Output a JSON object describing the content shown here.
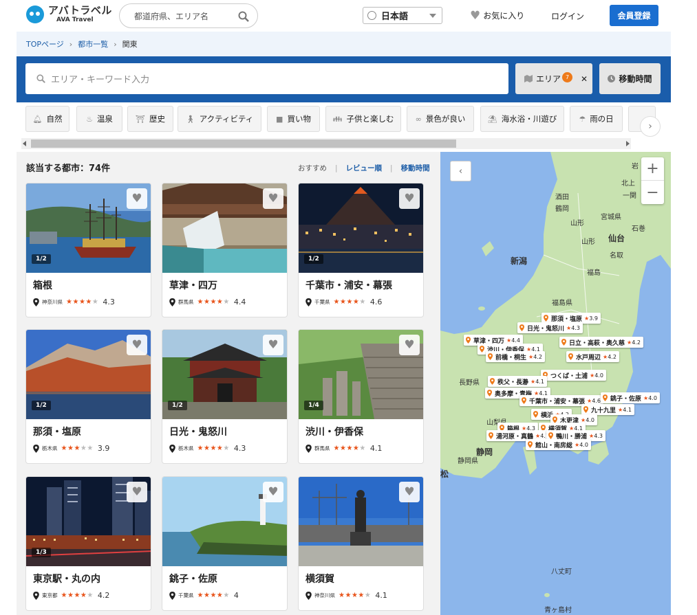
{
  "header": {
    "logo_jp": "アバトラベル",
    "logo_en": "AVA Travel",
    "search_placeholder": "都道府県、エリア名",
    "language": "日本語",
    "favorites": "お気に入り",
    "login": "ログイン",
    "register": "会員登録"
  },
  "breadcrumb": [
    "TOPページ",
    "都市一覧",
    "関東"
  ],
  "search": {
    "placeholder": "エリア・キーワード入力",
    "area_label": "エリア",
    "area_count": "7",
    "time_label": "移動時間"
  },
  "chips": [
    "自然",
    "温泉",
    "歴史",
    "アクティビティ",
    "買い物",
    "子供と楽しむ",
    "景色が良い",
    "海水浴・川遊び",
    "雨の日"
  ],
  "results": {
    "count_label": "該当する都市：74件",
    "sort_options": [
      "おすすめ",
      "レビュー順",
      "移動時間"
    ]
  },
  "cards": [
    {
      "name": "箱根",
      "pref": "神奈川県",
      "stars": 4,
      "rating": "4.3",
      "pager": "1/2"
    },
    {
      "name": "草津・四万",
      "pref": "群馬県",
      "stars": 4,
      "rating": "4.4",
      "pager": ""
    },
    {
      "name": "千葉市・浦安・幕張",
      "pref": "千葉県",
      "stars": 4,
      "rating": "4.6",
      "pager": "1/2"
    },
    {
      "name": "那須・塩原",
      "pref": "栃木県",
      "stars": 3,
      "rating": "3.9",
      "pager": "1/2"
    },
    {
      "name": "日光・鬼怒川",
      "pref": "栃木県",
      "stars": 4,
      "rating": "4.3",
      "pager": "1/2"
    },
    {
      "name": "渋川・伊香保",
      "pref": "群馬県",
      "stars": 4,
      "rating": "4.1",
      "pager": "1/4"
    },
    {
      "name": "東京駅・丸の内",
      "pref": "東京都",
      "stars": 4,
      "rating": "4.2",
      "pager": "1/3"
    },
    {
      "name": "銚子・佐原",
      "pref": "千葉県",
      "stars": 4,
      "rating": "4",
      "pager": ""
    },
    {
      "name": "横須賀",
      "pref": "神奈川県",
      "stars": 4,
      "rating": "4.1",
      "pager": ""
    }
  ],
  "map": {
    "labels": [
      "岩",
      "北上",
      "一関",
      "石巻",
      "酒田",
      "鶴岡",
      "山形",
      "宮城県",
      "山形",
      "仙台",
      "名取",
      "新潟",
      "福島",
      "福島県",
      "長野県",
      "山梨県",
      "静岡",
      "静岡県",
      "松",
      "八丈町",
      "青ヶ島村"
    ],
    "pins": [
      {
        "name": "那須・塩原",
        "rating": "3.9"
      },
      {
        "name": "日光・鬼怒川",
        "rating": "4.3"
      },
      {
        "name": "草津・四万",
        "rating": "4.4"
      },
      {
        "name": "渋川・伊香保",
        "rating": "4.1"
      },
      {
        "name": "日立・高萩・奥久慈",
        "rating": "4.2"
      },
      {
        "name": "前橋・桐生",
        "rating": "4.2"
      },
      {
        "name": "水戸周辺",
        "rating": "4.2"
      },
      {
        "name": "つくば・土浦",
        "rating": "4.0"
      },
      {
        "name": "秩父・長瀞",
        "rating": "4.1"
      },
      {
        "name": "奥多摩・青梅",
        "rating": "4.1"
      },
      {
        "name": "千葉市・浦安・幕張",
        "rating": "4.6"
      },
      {
        "name": "銚子・佐原",
        "rating": "4.0"
      },
      {
        "name": "九十九里",
        "rating": "4.1"
      },
      {
        "name": "横浜",
        "rating": "4.2"
      },
      {
        "name": "木更津",
        "rating": "4.0"
      },
      {
        "name": "箱根",
        "rating": "4.3"
      },
      {
        "name": "横須賀",
        "rating": "4.1"
      },
      {
        "name": "湯河原・真鶴",
        "rating": "4.1"
      },
      {
        "name": "鴨川・勝浦",
        "rating": "4.3"
      },
      {
        "name": "館山・南房総",
        "rating": "4.0"
      }
    ]
  },
  "colors": {
    "brand_blue": "#1a5dab",
    "register_blue": "#1a6ed0",
    "star": "#e8541b",
    "badge": "#ee7a1a",
    "map_water": "#8cb6eb",
    "map_land": "#c8e2b0"
  }
}
